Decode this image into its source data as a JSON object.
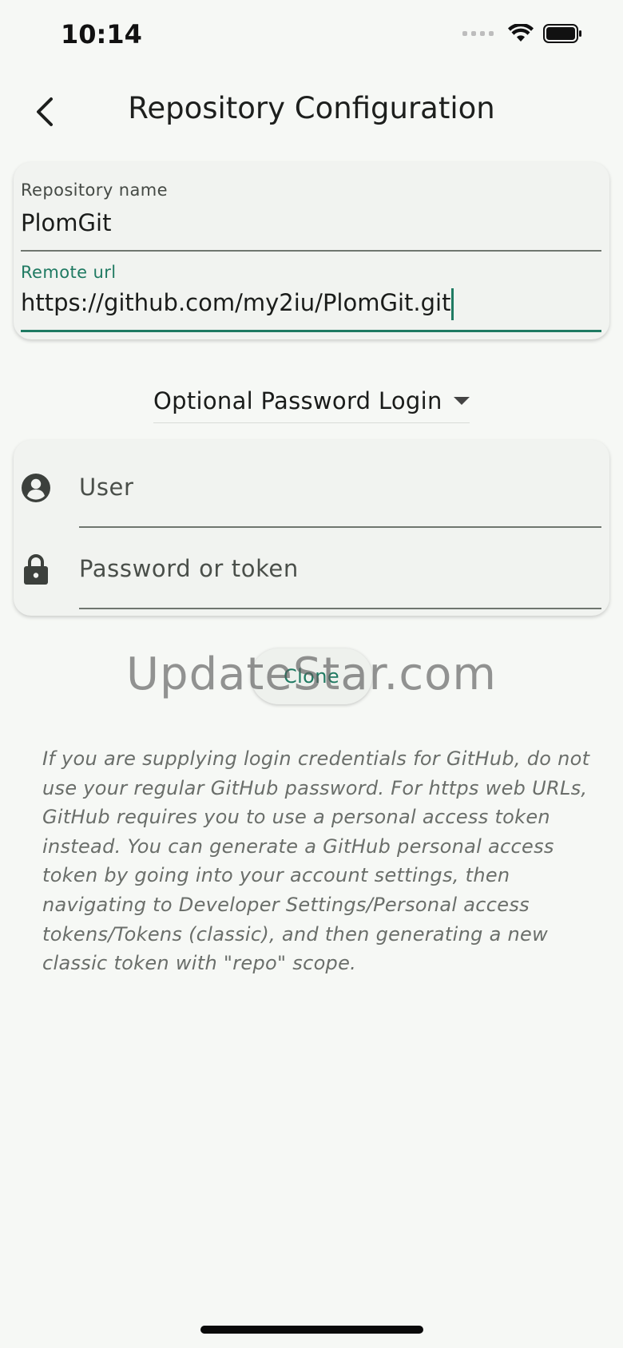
{
  "status_bar": {
    "time": "10:14"
  },
  "app_bar": {
    "title": "Repository Configuration",
    "back_icon": "chevron-left-icon"
  },
  "repo_form": {
    "name_label": "Repository name",
    "name_value": "PlomGit",
    "url_label": "Remote url",
    "url_value": "https://github.com/my2iu/PlomGit.git"
  },
  "login_mode": {
    "selected": "Optional Password Login"
  },
  "login_form": {
    "user_placeholder": "User",
    "user_icon": "account-circle-icon",
    "password_placeholder": "Password or token",
    "password_icon": "lock-icon"
  },
  "actions": {
    "clone_label": "Clone"
  },
  "watermark": "UpdateStar.com",
  "help_text": "If you are supplying login credentials for GitHub, do not use your regular GitHub password. For https web URLs, GitHub requires you to use a personal access token instead. You can generate a GitHub personal access token by going into your account settings, then navigating to Developer Settings/Personal access tokens/Tokens (classic), and then generating a new classic token with \"repo\" scope.",
  "colors": {
    "accent": "#1f7a62",
    "background": "#f6f8f5",
    "card": "#f1f3f0"
  }
}
